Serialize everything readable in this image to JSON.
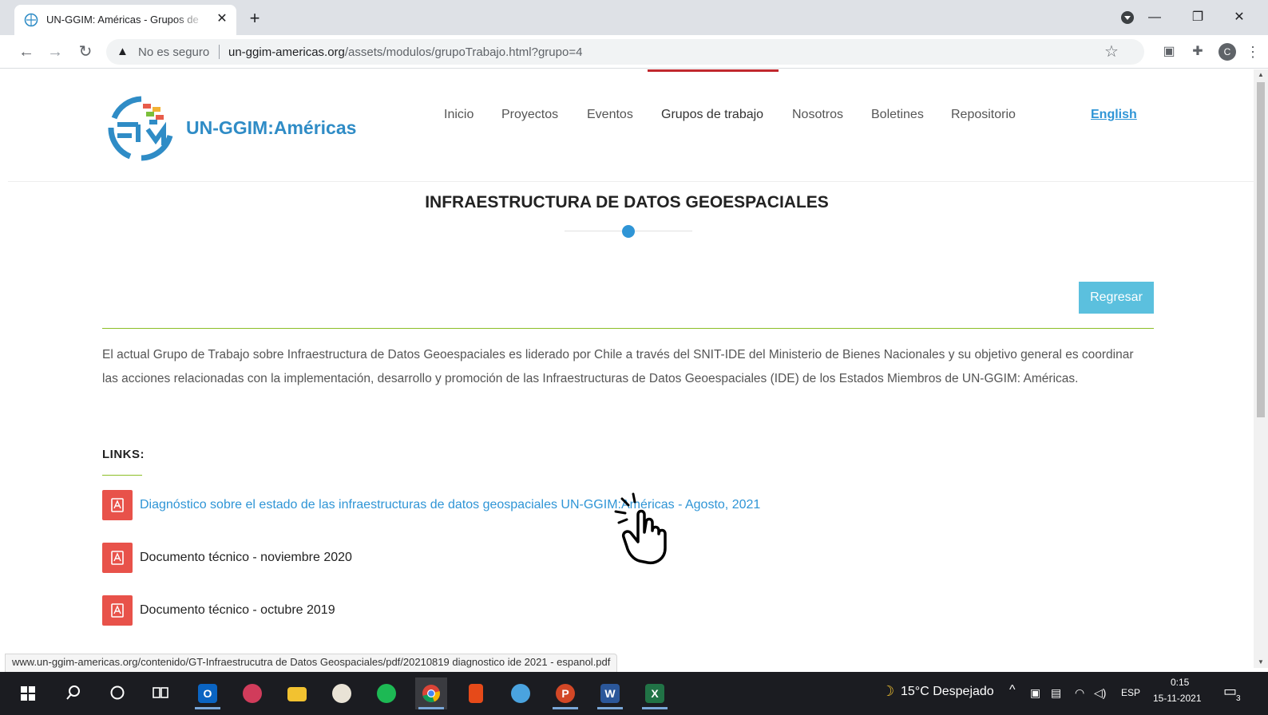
{
  "browser": {
    "tab_title": "UN-GGIM: Américas - Grupos de",
    "tab_close": "✕",
    "new_tab": "+",
    "security_label": "No es seguro",
    "url_host": "un-ggim-americas.org",
    "url_path": "/assets/modulos/grupoTrabajo.html?grupo=4",
    "profile_initial": "C",
    "status_url": "www.un-ggim-americas.org/contenido/GT-Infraestrucutra de Datos Geospaciales/pdf/20210819 diagnostico ide 2021 - espanol.pdf"
  },
  "site": {
    "logo_text": "UN-GGIM:Américas",
    "nav": [
      "Inicio",
      "Proyectos",
      "Eventos",
      "Grupos de trabajo",
      "Nosotros",
      "Boletines",
      "Repositorio"
    ],
    "active_nav": "Grupos de trabajo",
    "language_link": "English"
  },
  "main": {
    "title": "INFRAESTRUCTURA DE DATOS GEOESPACIALES",
    "back_button": "Regresar",
    "description": "El actual Grupo de Trabajo sobre Infraestructura de Datos Geoespaciales es liderado por Chile a través del SNIT-IDE del Ministerio de Bienes Nacionales y su objetivo general es coordinar las acciones relacionadas con la implementación, desarrollo y promoción de las Infraestructuras de Datos Geoespaciales (IDE) de los Estados Miembros de UN-GGIM: Américas.",
    "links_label": "LINKS:",
    "links": [
      "Diagnóstico sobre el estado de las infraestructuras de datos geospaciales UN-GGIM:Américas - Agosto, 2021",
      "Documento técnico - noviembre 2020",
      "Documento técnico - octubre 2019"
    ]
  },
  "taskbar": {
    "outlook": "O",
    "powerpoint": "P",
    "word": "W",
    "excel": "X",
    "weather": "15°C  Despejado",
    "language": "ESP",
    "time": "0:15",
    "date": "15-11-2021",
    "notifications": "3"
  }
}
